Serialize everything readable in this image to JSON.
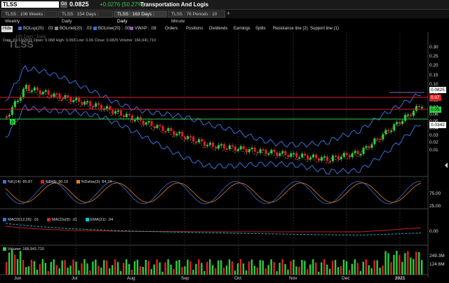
{
  "header": {
    "symbol": "TLSS",
    "go": "Go",
    "last": "0.0825",
    "change": "+0.0276 (50.27%)",
    "company": "Transportation And Logis"
  },
  "tabs": [
    {
      "label": "TLSS : 106  Weeks : Weekly"
    },
    {
      "label": "TLSS : 154  Days : Daily"
    },
    {
      "label": "TLSS : 163  Days : Daily"
    },
    {
      "label": "TLSS : 76  Periods : 10 Minute"
    }
  ],
  "add_tab": "+",
  "toolbar": {
    "hide": "Hide",
    "items": [
      "BOLup(20) : .03",
      "BOLmid(20) : .03",
      "BOLlow(20) : .00",
      "VWAP : .08",
      "Orders",
      "Positions",
      "Dividends",
      "Earnings",
      "Splits",
      "Resistance line (2)",
      "Support line (1)"
    ]
  },
  "info": {
    "watermark_symbol": "TLSS",
    "watermark_sub": "163 Days : Daily",
    "line": "Date: 01/13/2021  Open: 0.068  High: 0.093  Low: 0.06  Close: 0.0825  Volume: 166,941,710"
  },
  "price_axis": [
    "0.30",
    "0.25",
    "0.20",
    "0.15",
    "0.10",
    "0.09",
    "0.08",
    "0.07",
    "0.06",
    "0.05",
    "0.04",
    "0.03",
    "0.02",
    "0.01"
  ],
  "price_boxes": {
    "last": "0.0825",
    "resist": "0.07",
    "support": "0.05",
    "boll": "0.0342"
  },
  "stoch": {
    "legend": [
      "%K(14): 85.87",
      "%D(3): 90.10",
      "%Dslow(3): 84.74"
    ],
    "axis": [
      "75.00",
      "25.00"
    ]
  },
  "macd": {
    "legend": [
      "MACD(12,26): .01",
      "MACDs(9): .01",
      "EMA(21): .04"
    ],
    "axis": [
      "0.00"
    ]
  },
  "volume": {
    "legend": "Volume: 166,941,710",
    "axis": [
      "249.3M",
      "124.6M"
    ]
  },
  "months": [
    "Jun",
    "Jul",
    "Aug",
    "Sep",
    "Oct",
    "Nov",
    "Dec",
    "2021"
  ],
  "colors": {
    "up": "#2ecc40",
    "down": "#e02020",
    "boll": "#3b6fd8",
    "vwap": "#9b59b6",
    "resist": "#e02020",
    "support": "#2ecc40"
  }
}
